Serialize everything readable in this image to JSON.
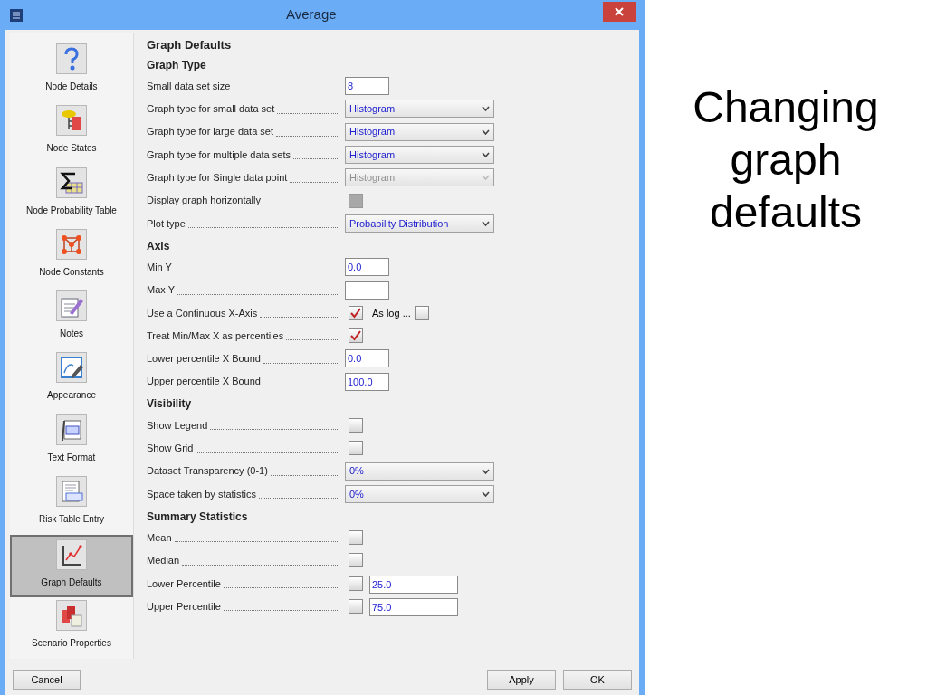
{
  "window": {
    "title": "Average"
  },
  "sidebar": {
    "items": [
      {
        "label": "Node Details",
        "selected": false
      },
      {
        "label": "Node States",
        "selected": false
      },
      {
        "label": "Node Probability Table",
        "selected": false
      },
      {
        "label": "Node Constants",
        "selected": false
      },
      {
        "label": "Notes",
        "selected": false
      },
      {
        "label": "Appearance",
        "selected": false
      },
      {
        "label": "Text Format",
        "selected": false
      },
      {
        "label": "Risk Table Entry",
        "selected": false
      },
      {
        "label": "Graph Defaults",
        "selected": true
      },
      {
        "label": "Scenario Properties",
        "selected": false
      }
    ]
  },
  "panel": {
    "title": "Graph Defaults",
    "sections": [
      {
        "heading": "Graph Type",
        "rows": [
          {
            "kind": "text",
            "label": "Small data set size",
            "value": "8"
          },
          {
            "kind": "select",
            "label": "Graph type for small data set",
            "value": "Histogram",
            "disabled": false
          },
          {
            "kind": "select",
            "label": "Graph type for large data set",
            "value": "Histogram",
            "disabled": false
          },
          {
            "kind": "select",
            "label": "Graph type for multiple data sets",
            "value": "Histogram",
            "disabled": false
          },
          {
            "kind": "select",
            "label": "Graph type for Single data point",
            "value": "Histogram",
            "disabled": true
          },
          {
            "kind": "checkbox",
            "label": "Display graph horizontally",
            "checked": false,
            "disabled": true,
            "dotted": false
          },
          {
            "kind": "select",
            "label": "Plot type",
            "value": "Probability Distribution",
            "disabled": false
          }
        ]
      },
      {
        "heading": "Axis",
        "rows": [
          {
            "kind": "text",
            "label": "Min Y",
            "value": "0.0"
          },
          {
            "kind": "text",
            "label": "Max Y"
          },
          {
            "kind": "checkbox",
            "label": "Use a Continuous X-Axis",
            "checked": true,
            "disabled": false,
            "extra": {
              "kind": "checkbox",
              "label": "As log ...",
              "checked": false
            }
          },
          {
            "kind": "checkbox",
            "label": "Treat Min/Max X as percentiles",
            "checked": true,
            "disabled": false
          },
          {
            "kind": "text",
            "label": "Lower percentile X Bound",
            "value": "0.0"
          },
          {
            "kind": "text",
            "label": "Upper percentile X Bound",
            "value": "100.0"
          }
        ]
      },
      {
        "heading": "Visibility",
        "rows": [
          {
            "kind": "checkbox",
            "label": "Show Legend",
            "checked": false,
            "disabled": false
          },
          {
            "kind": "checkbox",
            "label": "Show Grid",
            "checked": false,
            "disabled": false
          },
          {
            "kind": "select",
            "label": "Dataset Transparency (0-1)",
            "value": "0%",
            "disabled": false
          },
          {
            "kind": "select",
            "label": "Space taken by statistics",
            "value": "0%",
            "disabled": false
          }
        ]
      },
      {
        "heading": "Summary Statistics",
        "rows": [
          {
            "kind": "checkbox",
            "label": "Mean",
            "checked": false,
            "disabled": false
          },
          {
            "kind": "checkbox",
            "label": "Median",
            "checked": false,
            "disabled": false
          },
          {
            "kind": "checkbox",
            "label": "Lower Percentile",
            "checked": false,
            "disabled": false,
            "extra": {
              "kind": "text",
              "value": "25.0"
            }
          },
          {
            "kind": "checkbox",
            "label": "Upper Percentile",
            "checked": false,
            "disabled": false,
            "extra": {
              "kind": "text",
              "value": "75.0"
            }
          }
        ]
      }
    ]
  },
  "buttons": {
    "cancel": "Cancel",
    "apply": "Apply",
    "ok": "OK"
  },
  "slide_caption": "Changing graph defaults"
}
